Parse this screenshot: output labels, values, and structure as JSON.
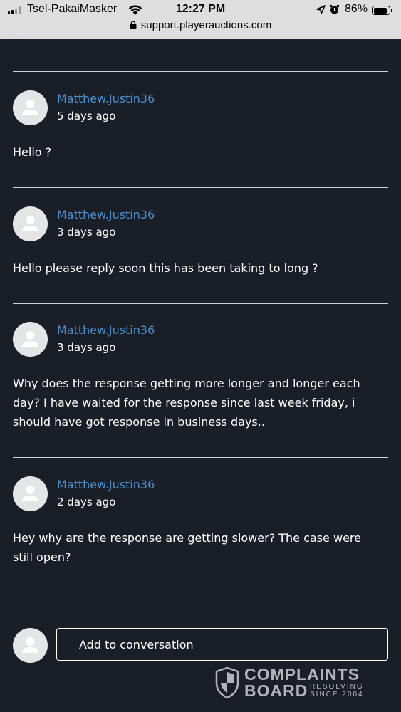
{
  "status_bar": {
    "carrier": "Tsel-PakaiMasker",
    "time": "12:27 PM",
    "battery": "86%"
  },
  "address_bar": {
    "url": "support.playerauctions.com"
  },
  "comments": [
    {
      "user": "Matthew.Justin36",
      "time": "5 days ago",
      "text": "Hello ?"
    },
    {
      "user": "Matthew.Justin36",
      "time": "3 days ago",
      "text": "Hello please reply soon this has been taking to long ?"
    },
    {
      "user": "Matthew.Justin36",
      "time": "3 days ago",
      "text": "Why does the response getting more longer and longer each day? I have waited for the response since last week friday, i should have got response in business days.."
    },
    {
      "user": "Matthew.Justin36",
      "time": "2 days ago",
      "text": "Hey why are the response are getting slower? The case were still open?"
    }
  ],
  "reply": {
    "placeholder": "Add to conversation"
  },
  "watermark": {
    "line1": "COMPLAINTS",
    "line2": "BOARD",
    "tagline1": "RESOLVING",
    "tagline2": "SINCE 2004"
  },
  "colors": {
    "background": "#1a1e27",
    "username": "#4a90cc",
    "divider": "#cfd2d8"
  }
}
